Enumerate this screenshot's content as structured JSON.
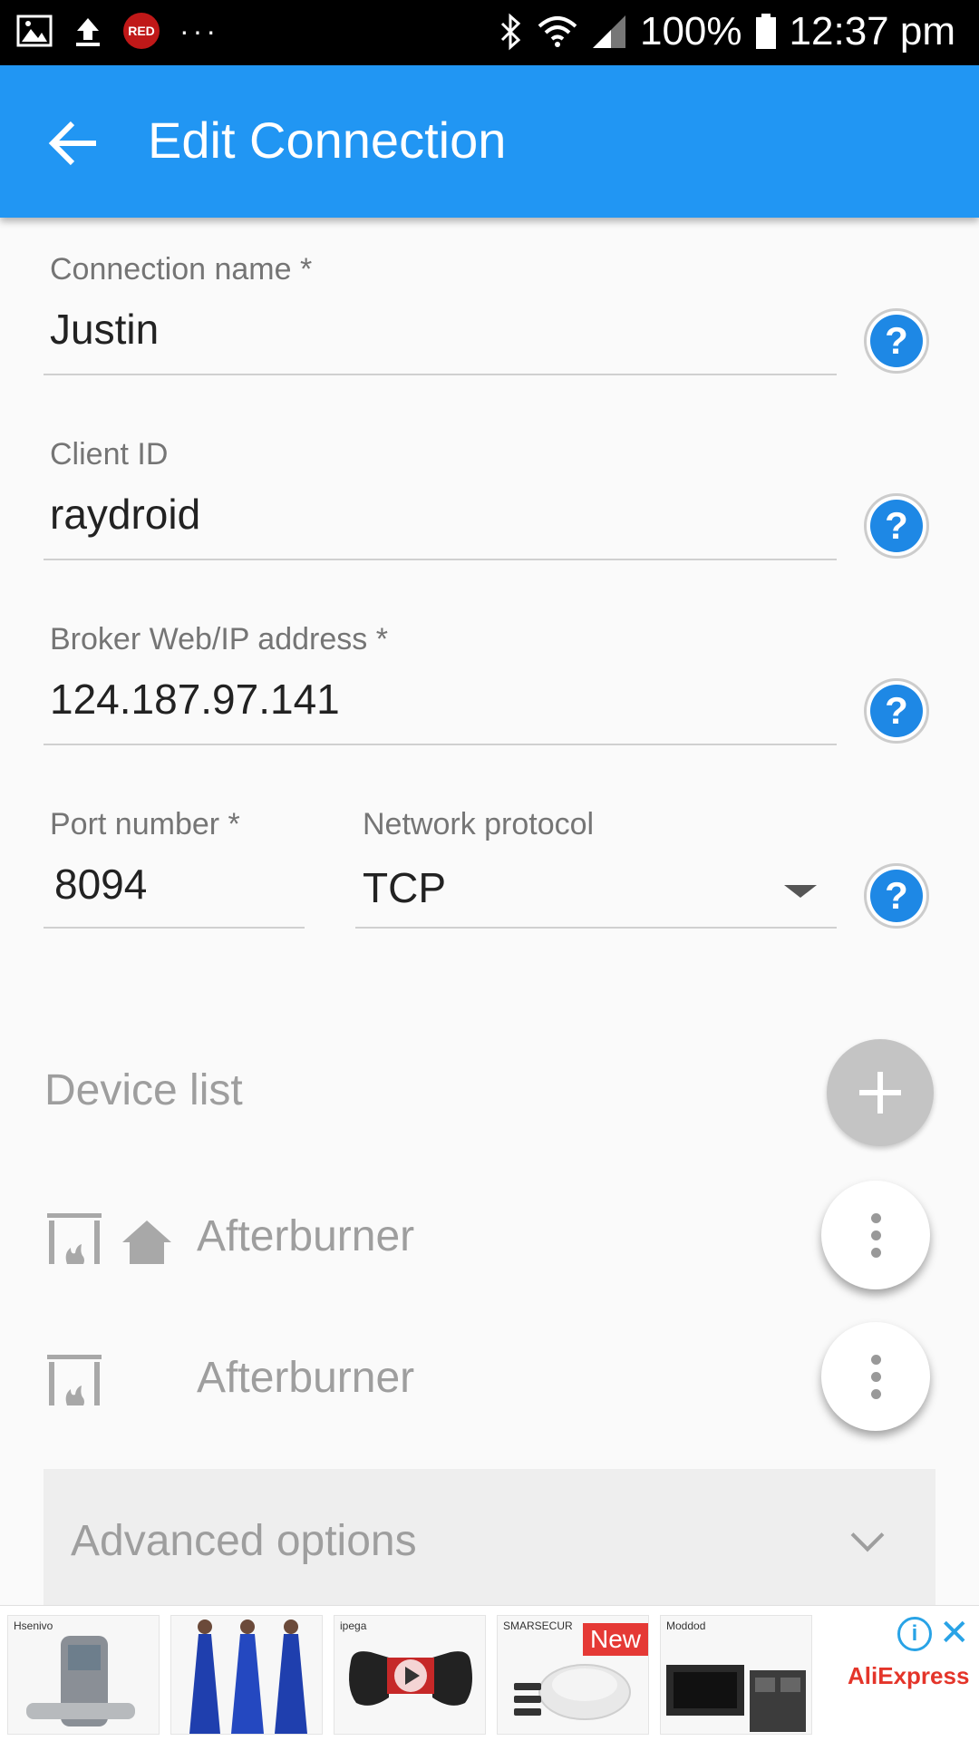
{
  "status_bar": {
    "red_badge": "RED",
    "more_dots": "···",
    "battery": "100%",
    "time": "12:37 pm"
  },
  "app_bar": {
    "title": "Edit Connection"
  },
  "form": {
    "connection_name": {
      "label": "Connection name *",
      "value": "Justin"
    },
    "client_id": {
      "label": "Client ID",
      "value": "raydroid"
    },
    "broker": {
      "label": "Broker Web/IP address *",
      "value": "124.187.97.141"
    },
    "port": {
      "label": "Port number *",
      "value": "8094"
    },
    "protocol": {
      "label": "Network protocol",
      "value": "TCP"
    },
    "help_glyph": "?"
  },
  "device_list": {
    "title": "Device list",
    "items": [
      {
        "name": "Afterburner",
        "home": true
      },
      {
        "name": "Afterburner",
        "home": false
      }
    ]
  },
  "advanced": {
    "label": "Advanced options"
  },
  "ad_bar": {
    "new_tag": "New",
    "brand_1": "Hsenivo",
    "brand_3": "ipega",
    "brand_4": "SMARSECUR",
    "brand_5": "Moddod",
    "advertiser": "AliExpress",
    "info_glyph": "i",
    "close_glyph": "✕"
  },
  "colors": {
    "app_bar": "#2196f3",
    "help_icon": "#1e88e5",
    "muted_text": "#9e9e9e"
  }
}
